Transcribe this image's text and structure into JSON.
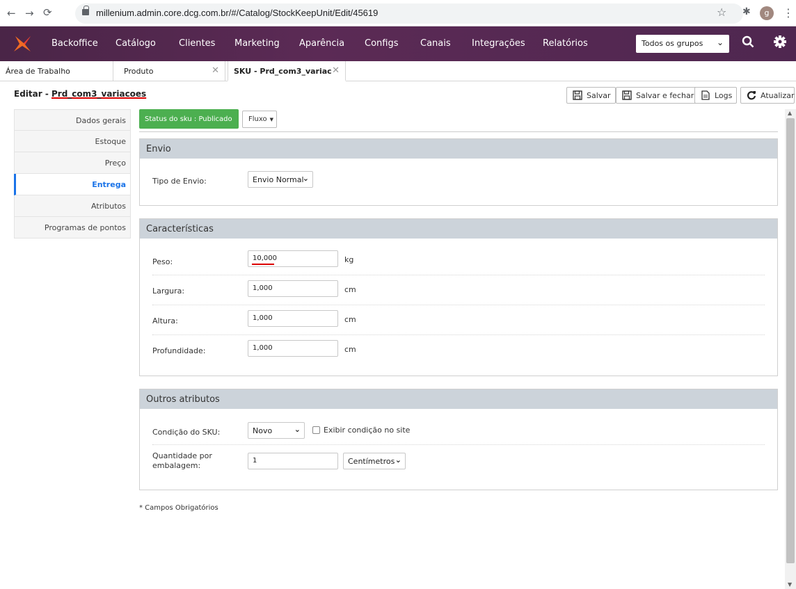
{
  "browser": {
    "url": "millenium.admin.core.dcg.com.br/#/Catalog/StockKeepUnit/Edit/45619",
    "avatar_letter": "g"
  },
  "topnav": {
    "brand": "Backoffice",
    "items": [
      "Catálogo",
      "Clientes",
      "Marketing",
      "Aparência",
      "Configs",
      "Canais",
      "Integrações",
      "Relatórios"
    ],
    "groups_select": "Todos os grupos"
  },
  "tabs": [
    {
      "label": "Área de Trabalho"
    },
    {
      "label": "Produto"
    },
    {
      "label": "SKU - Prd_com3_variac"
    }
  ],
  "page": {
    "title_prefix": "Editar - ",
    "title_name": "Prd_com3_variacoes"
  },
  "toolbar": {
    "save": "Salvar",
    "save_close": "Salvar e fechar",
    "logs": "Logs",
    "refresh": "Atualizar"
  },
  "sidebar": {
    "items": [
      "Dados gerais",
      "Estoque",
      "Preço",
      "Entrega",
      "Atributos",
      "Programas de pontos"
    ],
    "active": "Entrega"
  },
  "status": {
    "label": "Status do sku : Publicado",
    "flow": "Fluxo"
  },
  "envio": {
    "title": "Envio",
    "tipo_label": "Tipo de Envio:",
    "tipo_value": "Envio Normal"
  },
  "caracteristicas": {
    "title": "Características",
    "peso": {
      "label": "Peso:",
      "value": "10,000",
      "unit": "kg"
    },
    "largura": {
      "label": "Largura:",
      "value": "1,000",
      "unit": "cm"
    },
    "altura": {
      "label": "Altura:",
      "value": "1,000",
      "unit": "cm"
    },
    "profundidade": {
      "label": "Profundidade:",
      "value": "1,000",
      "unit": "cm"
    }
  },
  "outros": {
    "title": "Outros atributos",
    "condicao_label": "Condição do SKU:",
    "condicao_value": "Novo",
    "exibir_label": "Exibir condição no site",
    "qtd_label": "Quantidade por embalagem:",
    "qtd_value": "1",
    "qtd_unit": "Centímetros"
  },
  "note": "* Campos Obrigatórios",
  "colors": {
    "nav_bg": "#4f2750",
    "status_green": "#4caf50",
    "active_blue": "#1a73e8",
    "panel_header": "#ccd3da",
    "logo_orange": "#f06a24"
  }
}
